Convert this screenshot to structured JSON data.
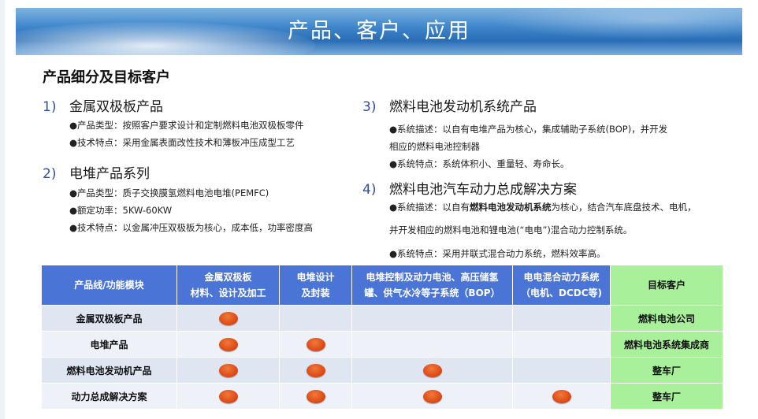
{
  "banner": {
    "title": "产品、客户、应用"
  },
  "subtitle": "产品细分及目标客户",
  "sections": [
    {
      "num": "1)",
      "title": "金属双极板产品",
      "bullets": [
        {
          "text": "●产品类型：按照客户要求设计和定制燃料电池双极板零件"
        },
        {
          "text": "●技术特点：采用金属表面改性技术和薄板冲压成型工艺"
        }
      ]
    },
    {
      "num": "2)",
      "title": "电堆产品系列",
      "bullets": [
        {
          "text": "●产品类型：质子交换膜氢燃料电池电堆(PEMFC)"
        },
        {
          "text": "●额定功率：5KW-60KW"
        },
        {
          "text": "●技术特点：以金属冲压双极板为核心，成本低，功率密度高"
        }
      ]
    },
    {
      "num": "3)",
      "title": "燃料电池发动机系统产品",
      "bullets": [
        {
          "text": "●系统描述：以自有电堆产品为核心，集成辅助子系统(BOP)，并开发"
        },
        {
          "text": "相应的燃料电池控制器"
        },
        {
          "text": "●系统特点：系统体积小、重量轻、寿命长。"
        }
      ]
    },
    {
      "num": "4)",
      "title": "燃料电池汽车动力总成解决方案",
      "bullets": [
        {
          "pre": "●系统描述：以自有",
          "bold": "燃料电池发动机系统",
          "post": "为核心，结合汽车底盘技术、电机，"
        },
        {
          "text": "并开发相应的燃料电池和锂电池(“电电”)混合动力控制系统。"
        },
        {
          "text": "●系统特点：采用并联式混合动力系统，燃料效率高。"
        }
      ]
    }
  ],
  "table": {
    "headers": [
      {
        "line1": "产品线/功能模块",
        "line2": ""
      },
      {
        "line1": "金属双极板",
        "line2": "材料、设计及加工"
      },
      {
        "line1": "电堆设计",
        "line2": "及封装"
      },
      {
        "line1": "电堆控制及动力电池、高压储氢",
        "line2": "罐、供气水冷等子系统（BOP）"
      },
      {
        "line1": "电电混合动力系统",
        "line2": "（电机、DCDC等)"
      },
      {
        "line1": "目标客户",
        "line2": ""
      }
    ],
    "rows": [
      {
        "name": "金属双极板产品",
        "marks": [
          true,
          false,
          false,
          false
        ],
        "target": "燃料电池公司"
      },
      {
        "name": "电堆产品",
        "marks": [
          true,
          true,
          false,
          false
        ],
        "target": "燃料电池系统集成商"
      },
      {
        "name": "燃料电池发动机产品",
        "marks": [
          true,
          true,
          true,
          false
        ],
        "target": "整车厂"
      },
      {
        "name": "动力总成解决方案",
        "marks": [
          true,
          true,
          true,
          true
        ],
        "target": "整车厂"
      }
    ],
    "mark_color": "#e0501a",
    "header_color": "#4a74d6",
    "target_color": "#a8f09a"
  }
}
